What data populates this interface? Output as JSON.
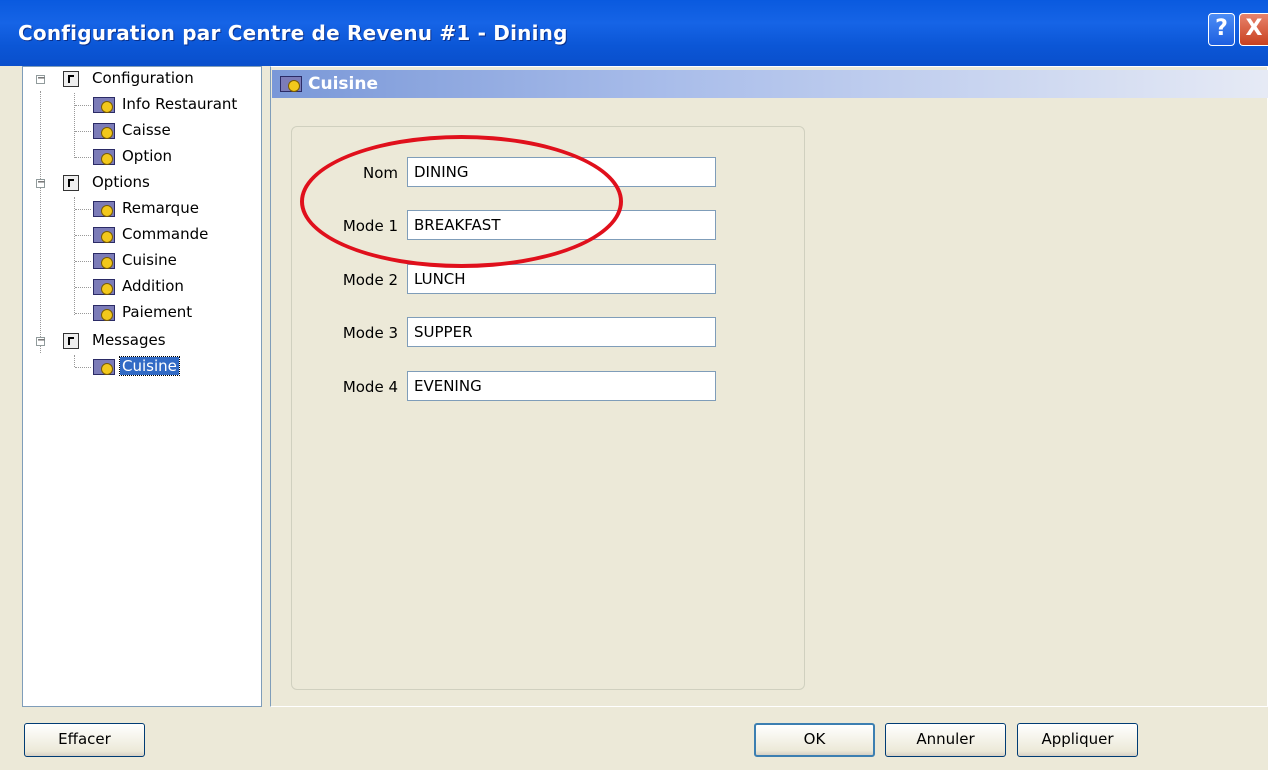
{
  "window": {
    "title": "Configuration par Centre de Revenu #1 - Dining",
    "help_label": "?",
    "close_label": "X"
  },
  "tree": {
    "groups": [
      {
        "label": "Configuration",
        "items": [
          "Info Restaurant",
          "Caisse",
          "Option"
        ]
      },
      {
        "label": "Options",
        "items": [
          "Remarque",
          "Commande",
          "Cuisine",
          "Addition",
          "Paiement"
        ]
      },
      {
        "label": "Messages",
        "items": [
          "Cuisine"
        ]
      }
    ],
    "selected": "Messages / Cuisine"
  },
  "section": {
    "title": "Cuisine"
  },
  "form": {
    "fields": [
      {
        "label": "Nom",
        "value": "DINING"
      },
      {
        "label": "Mode 1",
        "value": "BREAKFAST"
      },
      {
        "label": "Mode 2",
        "value": "LUNCH"
      },
      {
        "label": "Mode 3",
        "value": "SUPPER"
      },
      {
        "label": "Mode 4",
        "value": "EVENING"
      }
    ]
  },
  "buttons": {
    "clear": "Effacer",
    "ok": "OK",
    "cancel": "Annuler",
    "apply": "Appliquer"
  },
  "colors": {
    "titlebar": "#0a5adf",
    "highlight_ellipse": "#e0101c",
    "selection": "#316ac5"
  }
}
